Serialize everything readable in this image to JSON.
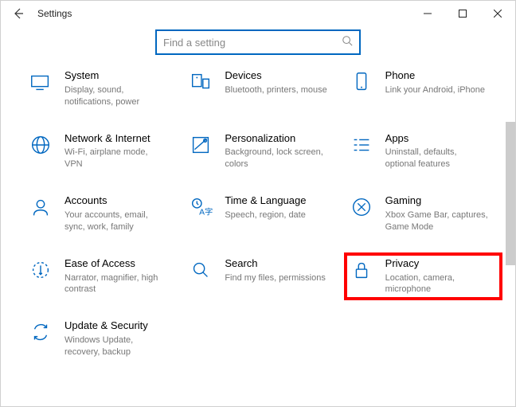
{
  "window": {
    "title": "Settings",
    "minimize": "—",
    "maximize": "☐",
    "close": "✕"
  },
  "search": {
    "placeholder": "Find a setting"
  },
  "categories": [
    {
      "id": "system",
      "title": "System",
      "sub": "Display, sound, notifications, power",
      "highlight": false
    },
    {
      "id": "devices",
      "title": "Devices",
      "sub": "Bluetooth, printers, mouse",
      "highlight": false
    },
    {
      "id": "phone",
      "title": "Phone",
      "sub": "Link your Android, iPhone",
      "highlight": false
    },
    {
      "id": "network",
      "title": "Network & Internet",
      "sub": "Wi-Fi, airplane mode, VPN",
      "highlight": false
    },
    {
      "id": "personalization",
      "title": "Personalization",
      "sub": "Background, lock screen, colors",
      "highlight": false
    },
    {
      "id": "apps",
      "title": "Apps",
      "sub": "Uninstall, defaults, optional features",
      "highlight": false
    },
    {
      "id": "accounts",
      "title": "Accounts",
      "sub": "Your accounts, email, sync, work, family",
      "highlight": false
    },
    {
      "id": "time",
      "title": "Time & Language",
      "sub": "Speech, region, date",
      "highlight": false
    },
    {
      "id": "gaming",
      "title": "Gaming",
      "sub": "Xbox Game Bar, captures, Game Mode",
      "highlight": false
    },
    {
      "id": "ease",
      "title": "Ease of Access",
      "sub": "Narrator, magnifier, high contrast",
      "highlight": false
    },
    {
      "id": "search-cat",
      "title": "Search",
      "sub": "Find my files, permissions",
      "highlight": false
    },
    {
      "id": "privacy",
      "title": "Privacy",
      "sub": "Location, camera, microphone",
      "highlight": true
    },
    {
      "id": "update",
      "title": "Update & Security",
      "sub": "Windows Update, recovery, backup",
      "highlight": false
    }
  ]
}
